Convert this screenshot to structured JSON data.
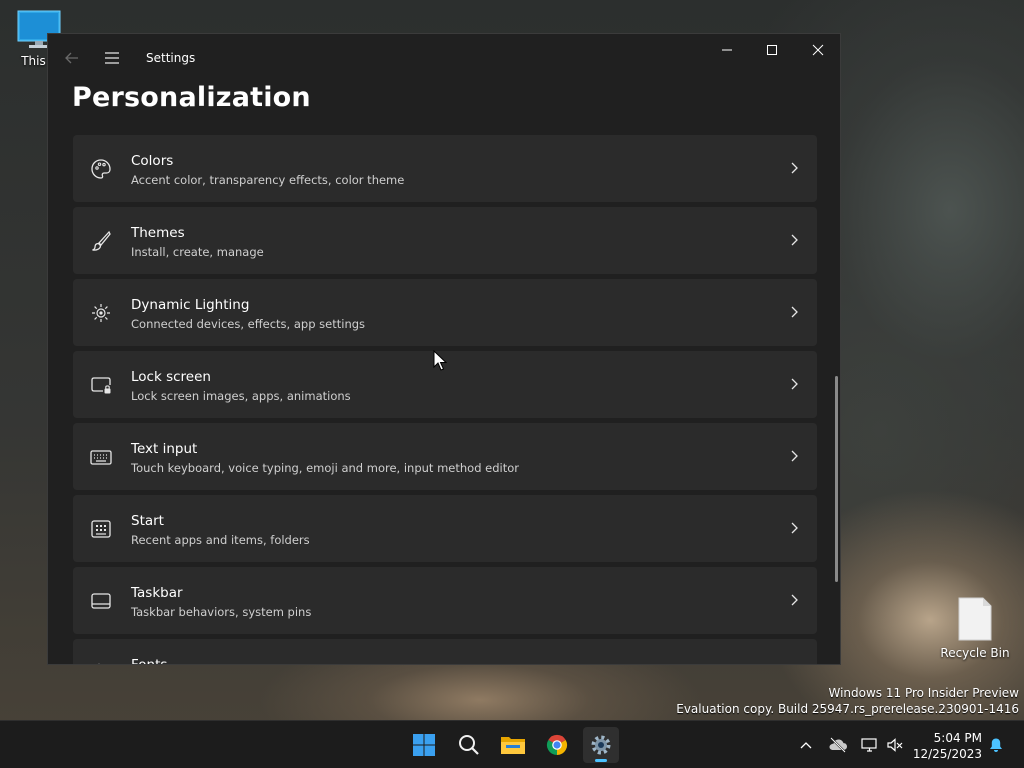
{
  "desktop": {
    "this_pc_label": "This P",
    "recycle_bin_label": "Recycle Bin",
    "watermark_line1": "Windows 11 Pro Insider Preview",
    "watermark_line2": "Evaluation copy. Build 25947.rs_prerelease.230901-1416"
  },
  "window": {
    "title": "Settings",
    "page_title": "Personalization",
    "items": [
      {
        "title": "Colors",
        "subtitle": "Accent color, transparency effects, color theme",
        "icon": "palette-icon"
      },
      {
        "title": "Themes",
        "subtitle": "Install, create, manage",
        "icon": "brush-icon"
      },
      {
        "title": "Dynamic Lighting",
        "subtitle": "Connected devices, effects, app settings",
        "icon": "dynamic-lighting-icon"
      },
      {
        "title": "Lock screen",
        "subtitle": "Lock screen images, apps, animations",
        "icon": "lock-screen-icon"
      },
      {
        "title": "Text input",
        "subtitle": "Touch keyboard, voice typing, emoji and more, input method editor",
        "icon": "keyboard-icon"
      },
      {
        "title": "Start",
        "subtitle": "Recent apps and items, folders",
        "icon": "start-menu-icon"
      },
      {
        "title": "Taskbar",
        "subtitle": "Taskbar behaviors, system pins",
        "icon": "taskbar-icon"
      },
      {
        "title": "Fonts",
        "subtitle": "",
        "icon": "fonts-icon"
      }
    ]
  },
  "taskbar": {
    "apps": [
      "start-icon",
      "search-icon",
      "file-explorer-icon",
      "chrome-icon",
      "settings-icon"
    ],
    "active_app": "settings-icon",
    "accent_color": "#4cc2ff",
    "time": "5:04 PM",
    "date": "12/25/2023"
  }
}
